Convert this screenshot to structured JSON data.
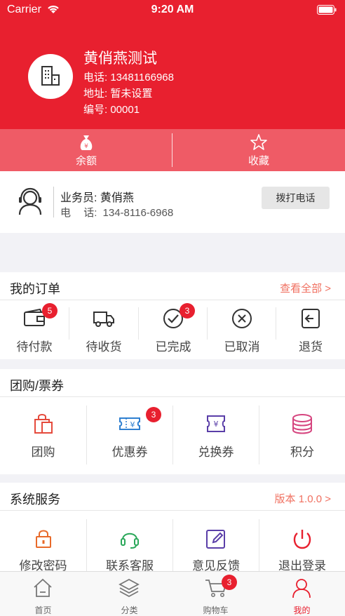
{
  "status": {
    "carrier": "Carrier",
    "time": "9:20 AM"
  },
  "profile": {
    "name": "黄俏燕测试",
    "phone": "电话: 13481166968",
    "address": "地址: 暂未设置",
    "number": "编号: 00001"
  },
  "wallet": {
    "balance": "余额",
    "favorites": "收藏"
  },
  "salesman": {
    "title": "业务员: 黄俏燕",
    "phone_label": "电",
    "phone_label2": "话:",
    "phone": "134-8116-6968",
    "call_button": "拨打电话"
  },
  "orders": {
    "title": "我的订单",
    "view_all": "查看全部 >",
    "items": [
      {
        "label": "待付款",
        "icon": "wallet-icon",
        "badge": "5"
      },
      {
        "label": "待收货",
        "icon": "truck-icon",
        "badge": ""
      },
      {
        "label": "已完成",
        "icon": "check-circle-icon",
        "badge": "3"
      },
      {
        "label": "已取消",
        "icon": "x-circle-icon",
        "badge": ""
      },
      {
        "label": "退货",
        "icon": "return-icon",
        "badge": ""
      }
    ]
  },
  "group": {
    "title": "团购/票券",
    "items": [
      {
        "label": "团购",
        "icon": "shopping-bag-icon",
        "badge": ""
      },
      {
        "label": "优惠券",
        "icon": "coupon-icon",
        "badge": "3"
      },
      {
        "label": "兑换券",
        "icon": "exchange-voucher-icon",
        "badge": ""
      },
      {
        "label": "积分",
        "icon": "points-stack-icon",
        "badge": ""
      }
    ]
  },
  "system": {
    "title": "系统服务",
    "version": "版本 1.0.0 >",
    "items": [
      {
        "label": "修改密码",
        "icon": "lock-icon"
      },
      {
        "label": "联系客服",
        "icon": "headset-icon"
      },
      {
        "label": "意见反馈",
        "icon": "edit-icon"
      },
      {
        "label": "退出登录",
        "icon": "power-icon"
      }
    ]
  },
  "tabbar": {
    "items": [
      {
        "label": "首页",
        "icon": "home-icon"
      },
      {
        "label": "分类",
        "icon": "layers-icon"
      },
      {
        "label": "购物车",
        "icon": "cart-icon",
        "badge": "3"
      },
      {
        "label": "我的",
        "icon": "user-icon",
        "active": true
      }
    ]
  },
  "colors": {
    "brand": "#e8202f",
    "accent_link": "#f07060"
  }
}
